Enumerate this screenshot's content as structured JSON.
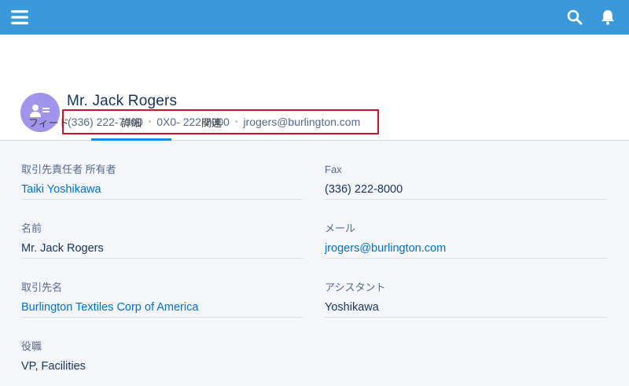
{
  "topbar": {
    "menu_icon": "hamburger-menu-icon",
    "search_icon": "search-icon",
    "bell_icon": "bell-icon",
    "color": "#3b99d9"
  },
  "header": {
    "avatar_icon": "contact-card-icon",
    "name": "Mr. Jack Rogers",
    "phone": "(336) 222-7000",
    "mobile": "0X0- 222-7000",
    "email": "jrogers@burlington.com",
    "separator": "•"
  },
  "tabs": [
    {
      "label": "フィード"
    },
    {
      "label": "詳細"
    },
    {
      "label": "関連"
    }
  ],
  "fields_left": [
    {
      "label": "取引先責任者 所有者",
      "value": "Taiki Yoshikawa"
    },
    {
      "label": "名前",
      "value": "Mr. Jack Rogers"
    },
    {
      "label": "取引先名",
      "value": "Burlington Textiles Corp of America"
    },
    {
      "label": "役職",
      "value": "VP, Facilities"
    }
  ],
  "fields_right": [
    {
      "label": "Fax",
      "value": "(336) 222-8000"
    },
    {
      "label": "メール",
      "value": "jrogers@burlington.com"
    },
    {
      "label": "アシスタント",
      "value": "Yoshikawa"
    }
  ]
}
